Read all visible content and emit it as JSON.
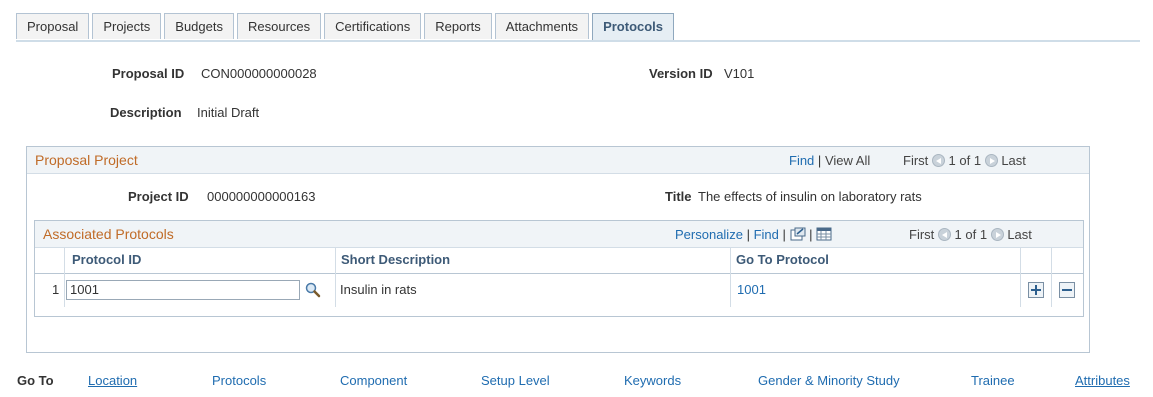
{
  "tabs": [
    {
      "label": "Proposal"
    },
    {
      "label": "Projects"
    },
    {
      "label": "Budgets"
    },
    {
      "label": "Resources"
    },
    {
      "label": "Certifications"
    },
    {
      "label": "Reports"
    },
    {
      "label": "Attachments"
    },
    {
      "label": "Protocols"
    }
  ],
  "header": {
    "proposal_id_label": "Proposal ID",
    "proposal_id_value": "CON000000000028",
    "version_id_label": "Version ID",
    "version_id_value": "V101",
    "description_label": "Description",
    "description_value": "Initial Draft"
  },
  "project_grid": {
    "title": "Proposal Project",
    "find": "Find",
    "sep": "|",
    "view_all": "View All",
    "first": "First",
    "count": "1 of 1",
    "last": "Last",
    "project_id_label": "Project ID",
    "project_id_value": "000000000000163",
    "title_label": "Title",
    "title_value": "The effects of insulin on laboratory rats"
  },
  "protocols_grid": {
    "title": "Associated Protocols",
    "personalize": "Personalize",
    "find": "Find",
    "sep": "|",
    "first": "First",
    "count": "1 of 1",
    "last": "Last",
    "columns": {
      "protocol_id": "Protocol ID",
      "short_description": "Short Description",
      "go_to_protocol": "Go To Protocol"
    },
    "rows": [
      {
        "num": "1",
        "protocol_id": "1001",
        "short_description": "Insulin in rats",
        "go_to_protocol": "1001"
      }
    ]
  },
  "goto": {
    "label": "Go To",
    "links": [
      "Location",
      "Protocols",
      "Component",
      "Setup Level",
      "Keywords",
      "Gender & Minority Study",
      "Trainee",
      "Attributes"
    ]
  },
  "colors": {
    "accent": "#c06b27",
    "link": "#1f6cb0",
    "header_text": "#3d5a77"
  }
}
